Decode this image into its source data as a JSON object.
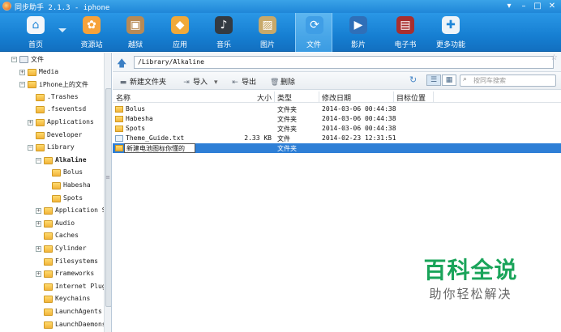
{
  "window": {
    "title": "同步助手 2.1.3 - iphone",
    "controls": [
      "menu-icon",
      "minimize-icon",
      "maximize-icon",
      "close-icon"
    ]
  },
  "toolbar": {
    "items": [
      {
        "label": "首页",
        "icon": "home-icon",
        "color": "#f3f6fa"
      },
      {
        "label": "资源站",
        "icon": "shopping-bag-icon",
        "color": "#f6a23a"
      },
      {
        "label": "越狱",
        "icon": "jailbreak-box-icon",
        "color": "#b78a56"
      },
      {
        "label": "应用",
        "icon": "apps-icon",
        "color": "#f0a93a"
      },
      {
        "label": "音乐",
        "icon": "music-icon",
        "color": "#333a42"
      },
      {
        "label": "图片",
        "icon": "picture-icon",
        "color": "#c8a96a"
      },
      {
        "label": "文件",
        "icon": "file-sync-icon",
        "color": "#3f9ee6"
      },
      {
        "label": "影片",
        "icon": "film-icon",
        "color": "#2f6fb8"
      },
      {
        "label": "电子书",
        "icon": "ebook-icon",
        "color": "#a82f2f"
      },
      {
        "label": "更多功能",
        "icon": "more-icon",
        "color": "#eef3f8"
      }
    ],
    "active": "文件"
  },
  "tree": {
    "nodes": [
      {
        "label": "文件",
        "exp": "−"
      },
      {
        "label": "Media",
        "exp": "+"
      },
      {
        "label": "iPhone上的文件",
        "exp": "−"
      },
      {
        "label": ".Trashes",
        "exp": ""
      },
      {
        "label": ".fseventsd",
        "exp": ""
      },
      {
        "label": "Applications",
        "exp": "+"
      },
      {
        "label": "Developer",
        "exp": ""
      },
      {
        "label": "Library",
        "exp": "−"
      },
      {
        "label": "Alkaline",
        "exp": "−"
      },
      {
        "label": "Bolus",
        "exp": ""
      },
      {
        "label": "Habesha",
        "exp": ""
      },
      {
        "label": "Spots",
        "exp": ""
      },
      {
        "label": "Application Su",
        "exp": "+"
      },
      {
        "label": "Audio",
        "exp": "+"
      },
      {
        "label": "Caches",
        "exp": ""
      },
      {
        "label": "Cylinder",
        "exp": "+"
      },
      {
        "label": "Filesystems",
        "exp": ""
      },
      {
        "label": "Frameworks",
        "exp": "+"
      },
      {
        "label": "Internet Plug-",
        "exp": ""
      },
      {
        "label": "Keychains",
        "exp": ""
      },
      {
        "label": "LaunchAgents",
        "exp": ""
      },
      {
        "label": "LaunchDaemons",
        "exp": ""
      }
    ],
    "selected": "Alkaline"
  },
  "pathbar": {
    "path": "/Library/Alkaline"
  },
  "actions": {
    "new_folder": "新建文件夹",
    "import": "导入",
    "export": "导出",
    "delete": "删除",
    "search_placeholder": "按同车搜索"
  },
  "columns": {
    "name": "名称",
    "size": "大小",
    "type": "类型",
    "modified": "修改日期",
    "target": "目标位置"
  },
  "files": [
    {
      "name": "Bolus",
      "size": "",
      "type": "文件夹",
      "modified": "2014-03-06 00:44:38",
      "kind": "folder"
    },
    {
      "name": "Habesha",
      "size": "",
      "type": "文件夹",
      "modified": "2014-03-06 00:44:38",
      "kind": "folder"
    },
    {
      "name": "Spots",
      "size": "",
      "type": "文件夹",
      "modified": "2014-03-06 00:44:38",
      "kind": "folder"
    },
    {
      "name": "Theme_Guide.txt",
      "size": "2.33 KB",
      "type": "文件",
      "modified": "2014-02-23 12:31:51",
      "kind": "doc"
    },
    {
      "name": "新建电池图标你懂的",
      "size": "",
      "type": "文件夹",
      "modified": "",
      "kind": "folder",
      "editing": true
    }
  ],
  "watermark": {
    "title": "百科全说",
    "subtitle": "助你轻松解决"
  }
}
